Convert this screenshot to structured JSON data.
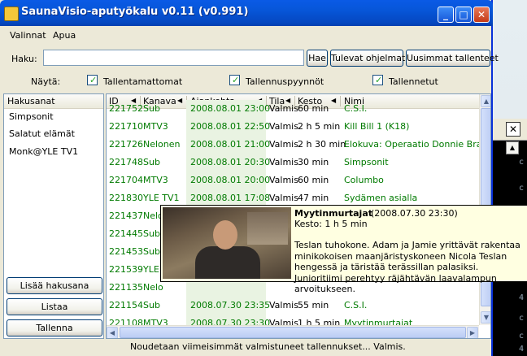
{
  "window": {
    "title": "SaunaVisio-aputyökalu v0.11 (v0.991)",
    "minimize": "_",
    "maximize": "□",
    "close": "✕"
  },
  "menu": [
    "Valinnat",
    "Apua"
  ],
  "search": {
    "label": "Haku:",
    "value": "",
    "search_button": "Hae",
    "upcoming_button": "Tulevat ohjelmat",
    "latest_button": "Uusimmat tallenteet"
  },
  "filters": {
    "label": "Näytä:",
    "options": [
      {
        "label": "Tallentamattomat",
        "checked": true
      },
      {
        "label": "Tallennuspyynnöt",
        "checked": true
      },
      {
        "label": "Tallennetut",
        "checked": true
      }
    ]
  },
  "keywords": {
    "header": "Hakusanat",
    "items": [
      "Simpsonit",
      "Salatut elämät",
      "Monk@YLE TV1"
    ],
    "add_button": "Lisää hakusana",
    "list_button": "Listaa",
    "save_button": "Tallenna"
  },
  "table": {
    "columns": [
      "ID",
      "Kanava",
      "Ajankohta",
      "Tila",
      "Kesto",
      "Nimi"
    ],
    "sort_arrow": "◀",
    "rows": [
      {
        "id": "221752",
        "channel": "Sub",
        "time": "2008.08.01 23:00",
        "state": "Valmis",
        "length": "60 min",
        "name": "C.S.I."
      },
      {
        "id": "221710",
        "channel": "MTV3",
        "time": "2008.08.01 22:50",
        "state": "Valmis",
        "length": "2 h 5 min",
        "name": "Kill Bill 1 (K18)"
      },
      {
        "id": "221726",
        "channel": "Nelonen",
        "time": "2008.08.01 21:00",
        "state": "Valmis",
        "length": "2 h 30 min",
        "name": "Elokuva: Operaatio Donnie Brasco"
      },
      {
        "id": "221748",
        "channel": "Sub",
        "time": "2008.08.01 20:30",
        "state": "Valmis",
        "length": "30 min",
        "name": "Simpsonit"
      },
      {
        "id": "221704",
        "channel": "MTV3",
        "time": "2008.08.01 20:00",
        "state": "Valmis",
        "length": "60 min",
        "name": "Columbo"
      },
      {
        "id": "221830",
        "channel": "YLE TV1",
        "time": "2008.08.01 17:08",
        "state": "Valmis",
        "length": "47 min",
        "name": "Sydämen asialla"
      },
      {
        "id": "221437",
        "channel": "Nelo",
        "time": "",
        "state": "",
        "length": "",
        "name": ""
      },
      {
        "id": "221445",
        "channel": "Sub",
        "time": "",
        "state": "",
        "length": "",
        "name": ""
      },
      {
        "id": "221453",
        "channel": "Sub",
        "time": "",
        "state": "",
        "length": "",
        "name": ""
      },
      {
        "id": "221539",
        "channel": "YLE",
        "time": "",
        "state": "",
        "length": "",
        "name": ""
      },
      {
        "id": "221135",
        "channel": "Nelo",
        "time": "",
        "state": "",
        "length": "",
        "name": ""
      },
      {
        "id": "221154",
        "channel": "Sub",
        "time": "2008.07.30 23:35",
        "state": "Valmis",
        "length": "55 min",
        "name": "C.S.I."
      },
      {
        "id": "221108",
        "channel": "MTV3",
        "time": "2008.07.30 23:30",
        "state": "Valmis",
        "length": "1 h 5 min",
        "name": "Myytinmurtajat"
      }
    ]
  },
  "tooltip": {
    "title": "Myytinmurtajat",
    "date": "(2008.07.30 23:30)",
    "length": "Kesto: 1 h 5 min",
    "description": "Teslan tuhokone. Adam ja Jamie yrittävät rakentaa minikokoisen maanjäristyskoneen Nicola Teslan hengessä ja täristää terässillan palasiksi. Junioritiimi perehtyy räjähtävän laavalampun arvoitukseen."
  },
  "status": "Noudetaan viimeisimmät valmistuneet tallennukset... Valmis.",
  "background_window": {
    "close": "✕",
    "scroll_up": "▲",
    "chars": [
      "c",
      "c",
      "c",
      "c",
      "4",
      "c",
      "c",
      "4"
    ]
  },
  "colors": {
    "titlebar": "#0a5ae6",
    "green_text": "#007a00",
    "tooltip_bg": "#ffffe1"
  }
}
